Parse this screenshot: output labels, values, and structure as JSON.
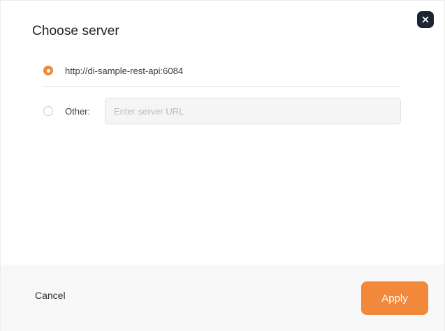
{
  "dialog": {
    "title": "Choose server",
    "close_icon": "close-icon"
  },
  "options": {
    "default_server": {
      "label": "http://di-sample-rest-api:6084",
      "selected": true
    },
    "other": {
      "label": "Other:",
      "selected": false,
      "input_value": "",
      "input_placeholder": "Enter server URL"
    }
  },
  "footer": {
    "cancel_label": "Cancel",
    "apply_label": "Apply"
  },
  "colors": {
    "accent": "#f2883a",
    "close_button_bg": "#1e2532",
    "footer_bg": "#f8f8f8"
  }
}
